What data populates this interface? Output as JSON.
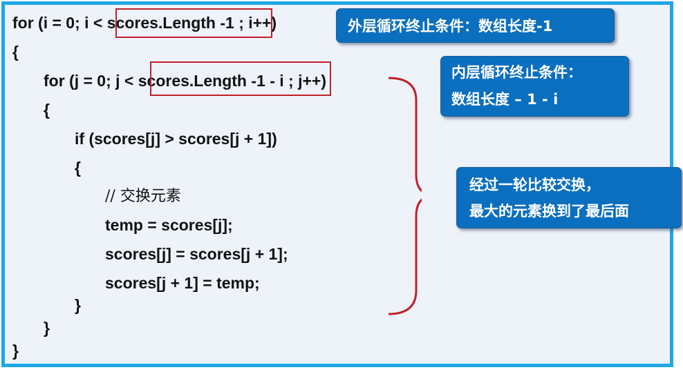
{
  "code": {
    "lines": [
      "for (i = 0; i < scores.Length -1 ; i++)",
      "{",
      "for (j = 0; j < scores.Length -1 - i ; j++)",
      "{",
      "if (scores[j] > scores[j + 1])",
      "{",
      "// 交换元素",
      "temp = scores[j];",
      "scores[j] = scores[j + 1];",
      "scores[j + 1] = temp;",
      "}",
      "}",
      "}"
    ]
  },
  "callouts": {
    "outer": "外层循环终止条件：数组长度-1",
    "inner_line1": "内层循环终止条件：",
    "inner_line2": "数组长度 – 1 - i",
    "result_line1": "经过一轮比较交换，",
    "result_line2": "最大的元素换到了最后面"
  },
  "colors": {
    "frame_border": "#1ea6e6",
    "background": "#eef2f9",
    "highlight_box": "#c0202a",
    "brace": "#c0202a",
    "callout_bg": "#0b6fbf",
    "callout_text": "#ffffff"
  }
}
